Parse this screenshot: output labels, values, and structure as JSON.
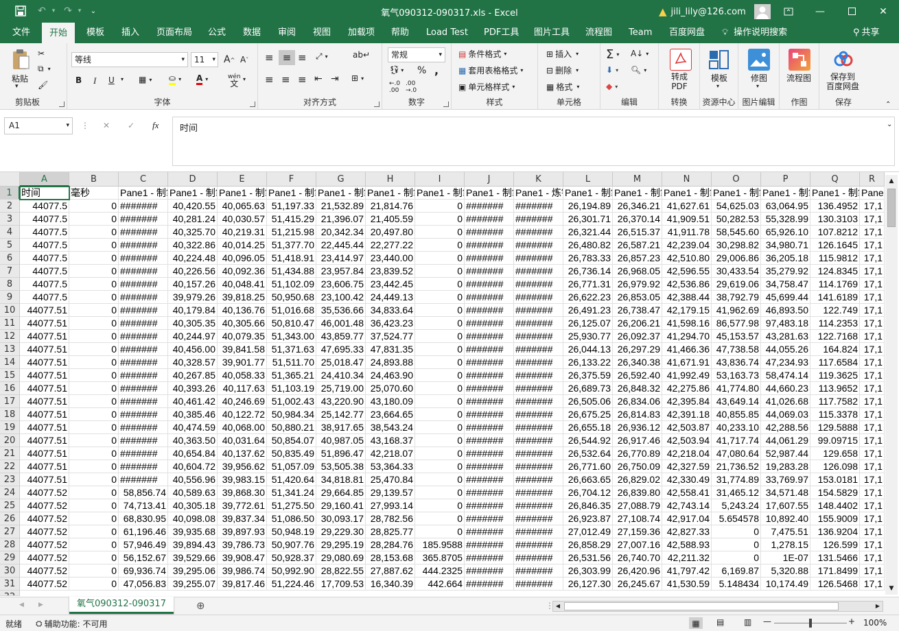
{
  "window": {
    "title": "氧气090312-090317.xls  -  Excel",
    "user": "jili_lily@126.com",
    "warning_icon": "warning-icon",
    "brand_color": "#217346"
  },
  "tabs": [
    "文件",
    "开始",
    "模板",
    "插入",
    "页面布局",
    "公式",
    "数据",
    "审阅",
    "视图",
    "加载项",
    "帮助",
    "Load Test",
    "PDF工具",
    "图片工具",
    "流程图",
    "Team",
    "百度网盘"
  ],
  "active_tab": "开始",
  "tell_me": "操作说明搜索",
  "share": "共享",
  "ribbon": {
    "clipboard": {
      "label": "剪贴板",
      "paste": "粘贴"
    },
    "font": {
      "label": "字体",
      "name": "等线",
      "size": "11",
      "bold": "B",
      "italic": "I",
      "underline": "U",
      "grow": "A",
      "shrink": "A",
      "phonetic": "wén",
      "phonetic_char": "文"
    },
    "alignment": {
      "label": "对齐方式"
    },
    "number": {
      "label": "数字",
      "format": "常规",
      "percent": "%",
      "comma": ","
    },
    "styles": {
      "label": "样式",
      "conditional": "条件格式",
      "table": "套用表格格式",
      "cell_styles": "单元格样式"
    },
    "cells": {
      "label": "单元格",
      "insert": "插入",
      "delete": "删除",
      "format": "格式"
    },
    "editing": {
      "label": "编辑"
    },
    "convert": {
      "label": "转换",
      "button": "转成\nPDF"
    },
    "resource": {
      "label": "资源中心",
      "button": "模板"
    },
    "image_edit": {
      "label": "图片编辑",
      "button": "修图"
    },
    "drawing": {
      "label": "作图",
      "button": "流程图"
    },
    "save": {
      "label": "保存",
      "button": "保存到\n百度网盘"
    }
  },
  "formula_bar": {
    "name_box": "A1",
    "cancel": "✕",
    "enter": "✓",
    "fx": "fx",
    "value": "时间"
  },
  "columns": [
    "A",
    "B",
    "C",
    "D",
    "E",
    "F",
    "G",
    "H",
    "I",
    "J",
    "K",
    "L",
    "M",
    "N",
    "O",
    "P",
    "Q",
    "R"
  ],
  "rows": [
    [
      "时间",
      "毫秒",
      "Pane1 - 制氧",
      "Pane1 - 制氧",
      "Pane1 - 制氧",
      "Pane1 - 制氧",
      "Pane1 - 制氧",
      "Pane1 - 制氧",
      "Pane1 - 制氧",
      "Pane1 - 制氧",
      "Pane1 - 炼钢",
      "Pane1 - 制氧",
      "Pane1 - 制氧",
      "Pane1 - 制氧",
      "Pane1 - 制氧",
      "Pane1 - 制氧",
      "Pane1 - 制氧",
      "Pane"
    ],
    [
      "44077.5",
      "0",
      "#######",
      "40,420.55",
      "40,065.63",
      "51,197.33",
      "21,532.89",
      "21,814.76",
      "0",
      "#######",
      "#######",
      "26,194.89",
      "26,346.21",
      "41,627.61",
      "54,625.03",
      "63,064.95",
      "136.4952",
      "17,1"
    ],
    [
      "44077.5",
      "0",
      "#######",
      "40,281.24",
      "40,030.57",
      "51,415.29",
      "21,396.07",
      "21,405.59",
      "0",
      "#######",
      "#######",
      "26,301.71",
      "26,370.14",
      "41,909.51",
      "50,282.53",
      "55,328.99",
      "130.3103",
      "17,1"
    ],
    [
      "44077.5",
      "0",
      "#######",
      "40,325.70",
      "40,219.31",
      "51,215.98",
      "20,342.34",
      "20,497.80",
      "0",
      "#######",
      "#######",
      "26,321.44",
      "26,515.37",
      "41,911.78",
      "58,545.60",
      "65,926.10",
      "107.8212",
      "17,1"
    ],
    [
      "44077.5",
      "0",
      "#######",
      "40,322.86",
      "40,014.25",
      "51,377.70",
      "22,445.44",
      "22,277.22",
      "0",
      "#######",
      "#######",
      "26,480.82",
      "26,587.21",
      "42,239.04",
      "30,298.82",
      "34,980.71",
      "126.1645",
      "17,1"
    ],
    [
      "44077.5",
      "0",
      "#######",
      "40,224.48",
      "40,096.05",
      "51,418.91",
      "23,414.97",
      "23,440.00",
      "0",
      "#######",
      "#######",
      "26,783.33",
      "26,857.23",
      "42,510.80",
      "29,006.86",
      "36,205.18",
      "115.9812",
      "17,1"
    ],
    [
      "44077.5",
      "0",
      "#######",
      "40,226.56",
      "40,092.36",
      "51,434.88",
      "23,957.84",
      "23,839.52",
      "0",
      "#######",
      "#######",
      "26,736.14",
      "26,968.05",
      "42,596.55",
      "30,433.54",
      "35,279.92",
      "124.8345",
      "17,1"
    ],
    [
      "44077.5",
      "0",
      "#######",
      "40,157.26",
      "40,048.41",
      "51,102.09",
      "23,606.75",
      "23,442.45",
      "0",
      "#######",
      "#######",
      "26,771.31",
      "26,979.92",
      "42,536.86",
      "29,619.06",
      "34,758.47",
      "114.1769",
      "17,1"
    ],
    [
      "44077.5",
      "0",
      "#######",
      "39,979.26",
      "39,818.25",
      "50,950.68",
      "23,100.42",
      "24,449.13",
      "0",
      "#######",
      "#######",
      "26,622.23",
      "26,853.05",
      "42,388.44",
      "38,792.79",
      "45,699.44",
      "141.6189",
      "17,1"
    ],
    [
      "44077.51",
      "0",
      "#######",
      "40,179.84",
      "40,136.76",
      "51,016.68",
      "35,536.66",
      "34,833.64",
      "0",
      "#######",
      "#######",
      "26,491.23",
      "26,738.47",
      "42,179.15",
      "41,962.69",
      "46,893.50",
      "122.749",
      "17,1"
    ],
    [
      "44077.51",
      "0",
      "#######",
      "40,305.35",
      "40,305.66",
      "50,810.47",
      "46,001.48",
      "36,423.23",
      "0",
      "#######",
      "#######",
      "26,125.07",
      "26,206.21",
      "41,598.16",
      "86,577.98",
      "97,483.18",
      "114.2353",
      "17,1"
    ],
    [
      "44077.51",
      "0",
      "#######",
      "40,244.97",
      "40,079.35",
      "51,343.00",
      "43,859.77",
      "37,524.77",
      "0",
      "#######",
      "#######",
      "25,930.77",
      "26,092.37",
      "41,294.70",
      "45,153.57",
      "43,281.63",
      "122.7168",
      "17,1"
    ],
    [
      "44077.51",
      "0",
      "#######",
      "40,456.00",
      "39,841.58",
      "51,371.63",
      "47,695.33",
      "47,831.35",
      "0",
      "#######",
      "#######",
      "26,044.13",
      "26,297.29",
      "41,466.36",
      "47,738.58",
      "44,055.26",
      "164.824",
      "17,1"
    ],
    [
      "44077.51",
      "0",
      "#######",
      "40,328.57",
      "39,901.77",
      "51,511.70",
      "25,018.47",
      "24,893.88",
      "0",
      "#######",
      "#######",
      "26,133.22",
      "26,340.38",
      "41,671.91",
      "43,836.74",
      "47,234.93",
      "117.6584",
      "17,1"
    ],
    [
      "44077.51",
      "0",
      "#######",
      "40,267.85",
      "40,058.33",
      "51,365.21",
      "24,410.34",
      "24,463.90",
      "0",
      "#######",
      "#######",
      "26,375.59",
      "26,592.40",
      "41,992.49",
      "53,163.73",
      "58,474.14",
      "119.3625",
      "17,1"
    ],
    [
      "44077.51",
      "0",
      "#######",
      "40,393.26",
      "40,117.63",
      "51,103.19",
      "25,719.00",
      "25,070.60",
      "0",
      "#######",
      "#######",
      "26,689.73",
      "26,848.32",
      "42,275.86",
      "41,774.80",
      "44,660.23",
      "113.9652",
      "17,1"
    ],
    [
      "44077.51",
      "0",
      "#######",
      "40,461.42",
      "40,246.69",
      "51,002.43",
      "43,220.90",
      "43,180.09",
      "0",
      "#######",
      "#######",
      "26,505.06",
      "26,834.06",
      "42,395.84",
      "43,649.14",
      "41,026.68",
      "117.7582",
      "17,1"
    ],
    [
      "44077.51",
      "0",
      "#######",
      "40,385.46",
      "40,122.72",
      "50,984.34",
      "25,142.77",
      "23,664.65",
      "0",
      "#######",
      "#######",
      "26,675.25",
      "26,814.83",
      "42,391.18",
      "40,855.85",
      "44,069.03",
      "115.3378",
      "17,1"
    ],
    [
      "44077.51",
      "0",
      "#######",
      "40,474.59",
      "40,068.00",
      "50,880.21",
      "38,917.65",
      "38,543.24",
      "0",
      "#######",
      "#######",
      "26,655.18",
      "26,936.12",
      "42,503.87",
      "40,233.10",
      "42,288.56",
      "129.5888",
      "17,1"
    ],
    [
      "44077.51",
      "0",
      "#######",
      "40,363.50",
      "40,031.64",
      "50,854.07",
      "40,987.05",
      "43,168.37",
      "0",
      "#######",
      "#######",
      "26,544.92",
      "26,917.46",
      "42,503.94",
      "41,717.74",
      "44,061.29",
      "99.09715",
      "17,1"
    ],
    [
      "44077.51",
      "0",
      "#######",
      "40,654.84",
      "40,137.62",
      "50,835.49",
      "51,896.47",
      "42,218.07",
      "0",
      "#######",
      "#######",
      "26,532.64",
      "26,770.89",
      "42,218.04",
      "47,080.64",
      "52,987.44",
      "129.658",
      "17,1"
    ],
    [
      "44077.51",
      "0",
      "#######",
      "40,604.72",
      "39,956.62",
      "51,057.09",
      "53,505.38",
      "53,364.33",
      "0",
      "#######",
      "#######",
      "26,771.60",
      "26,750.09",
      "42,327.59",
      "21,736.52",
      "19,283.28",
      "126.098",
      "17,1"
    ],
    [
      "44077.51",
      "0",
      "#######",
      "40,556.96",
      "39,983.15",
      "51,420.64",
      "34,818.81",
      "25,470.84",
      "0",
      "#######",
      "#######",
      "26,663.65",
      "26,829.02",
      "42,330.49",
      "31,774.89",
      "33,769.97",
      "153.0181",
      "17,1"
    ],
    [
      "44077.52",
      "0",
      "58,856.74",
      "40,589.63",
      "39,868.30",
      "51,341.24",
      "29,664.85",
      "29,139.57",
      "0",
      "#######",
      "#######",
      "26,704.12",
      "26,839.80",
      "42,558.41",
      "31,465.12",
      "34,571.48",
      "154.5829",
      "17,1"
    ],
    [
      "44077.52",
      "0",
      "74,713.41",
      "40,305.18",
      "39,772.61",
      "51,275.50",
      "29,160.41",
      "27,993.14",
      "0",
      "#######",
      "#######",
      "26,846.35",
      "27,088.79",
      "42,743.14",
      "5,243.24",
      "17,607.55",
      "148.4402",
      "17,1"
    ],
    [
      "44077.52",
      "0",
      "68,830.95",
      "40,098.08",
      "39,837.34",
      "51,086.50",
      "30,093.17",
      "28,782.56",
      "0",
      "#######",
      "#######",
      "26,923.87",
      "27,108.74",
      "42,917.04",
      "5.654578",
      "10,892.40",
      "155.9009",
      "17,1"
    ],
    [
      "44077.52",
      "0",
      "61,196.46",
      "39,935.68",
      "39,897.93",
      "50,948.19",
      "29,229.30",
      "28,825.77",
      "0",
      "#######",
      "#######",
      "27,012.49",
      "27,159.36",
      "42,827.33",
      "0",
      "7,475.51",
      "136.9204",
      "17,1"
    ],
    [
      "44077.52",
      "0",
      "57,946.49",
      "39,894.43",
      "39,786.73",
      "50,907.76",
      "29,295.19",
      "28,284.76",
      "185.9588",
      "#######",
      "#######",
      "26,858.29",
      "27,007.16",
      "42,588.93",
      "0",
      "1,278.15",
      "126.599",
      "17,1"
    ],
    [
      "44077.52",
      "0",
      "56,152.67",
      "39,529.66",
      "39,908.47",
      "50,928.37",
      "29,080.69",
      "28,153.68",
      "365.8705",
      "#######",
      "#######",
      "26,531.56",
      "26,740.70",
      "42,211.32",
      "0",
      "1E-07",
      "131.5466",
      "17,1"
    ],
    [
      "44077.52",
      "0",
      "69,936.74",
      "39,295.06",
      "39,986.74",
      "50,992.90",
      "28,822.55",
      "27,887.62",
      "444.2325",
      "#######",
      "#######",
      "26,303.99",
      "26,420.96",
      "41,797.42",
      "6,169.87",
      "5,320.88",
      "171.8499",
      "17,1"
    ],
    [
      "44077.52",
      "0",
      "47,056.83",
      "39,255.07",
      "39,817.46",
      "51,224.46",
      "17,709.53",
      "16,340.39",
      "442.664",
      "#######",
      "#######",
      "26,127.30",
      "26,245.67",
      "41,530.59",
      "5.148434",
      "10,174.49",
      "126.5468",
      "17,1"
    ]
  ],
  "sheet_tab": "氧气090312-090317",
  "status": {
    "ready": "就绪",
    "accessibility": "辅助功能: 不可用",
    "zoom": "100%"
  }
}
